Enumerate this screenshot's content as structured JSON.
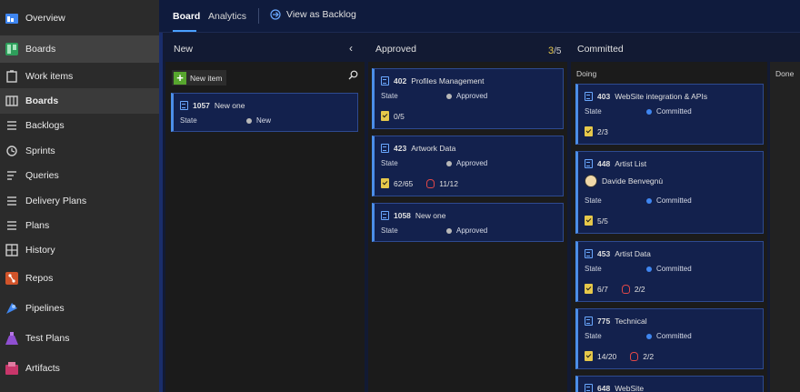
{
  "sidebar": {
    "items": [
      {
        "label": "Overview",
        "icon": "overview-icon"
      },
      {
        "label": "Boards",
        "icon": "boards-hub-icon"
      },
      {
        "label": "Work items",
        "icon": "work-items-icon"
      },
      {
        "label": "Boards",
        "icon": "boards-icon"
      },
      {
        "label": "Backlogs",
        "icon": "backlogs-icon"
      },
      {
        "label": "Sprints",
        "icon": "sprints-icon"
      },
      {
        "label": "Queries",
        "icon": "queries-icon"
      },
      {
        "label": "Delivery Plans",
        "icon": "delivery-plans-icon"
      },
      {
        "label": "Plans",
        "icon": "plans-icon"
      },
      {
        "label": "History",
        "icon": "history-icon"
      },
      {
        "label": "Repos",
        "icon": "repos-icon"
      },
      {
        "label": "Pipelines",
        "icon": "pipelines-icon"
      },
      {
        "label": "Test Plans",
        "icon": "test-plans-icon"
      },
      {
        "label": "Artifacts",
        "icon": "artifacts-icon"
      }
    ]
  },
  "header": {
    "tabs": [
      "Board",
      "Analytics"
    ],
    "view_as_backlog": "View as Backlog"
  },
  "columns": {
    "new": {
      "title": "New",
      "new_item": "New item"
    },
    "approved": {
      "title": "Approved",
      "count": "3",
      "limit": "/5"
    },
    "committed": {
      "title": "Committed",
      "doing": "Doing",
      "done": "Done"
    }
  },
  "cards": {
    "c1057": {
      "id": "1057",
      "name": "New one",
      "state_label": "State",
      "state": "New"
    },
    "c402": {
      "id": "402",
      "name": "Profiles Management",
      "state_label": "State",
      "state": "Approved",
      "tasks": "0/5"
    },
    "c423": {
      "id": "423",
      "name": "Artwork Data",
      "state_label": "State",
      "state": "Approved",
      "tasks": "62/65",
      "bugs": "11/12"
    },
    "c1058": {
      "id": "1058",
      "name": "New one",
      "state_label": "State",
      "state": "Approved"
    },
    "c403": {
      "id": "403",
      "name": "WebSite integration & APIs",
      "state_label": "State",
      "state": "Committed",
      "tasks": "2/3"
    },
    "c448": {
      "id": "448",
      "name": "Artist List",
      "assignee": "Davide Benvegnù",
      "state_label": "State",
      "state": "Committed",
      "tasks": "5/5"
    },
    "c453": {
      "id": "453",
      "name": "Artist Data",
      "state_label": "State",
      "state": "Committed",
      "tasks": "6/7",
      "bugs": "2/2"
    },
    "c775": {
      "id": "775",
      "name": "Technical",
      "state_label": "State",
      "state": "Committed",
      "tasks": "14/20",
      "bugs": "2/2"
    },
    "c648": {
      "id": "648",
      "name": "WebSite"
    }
  }
}
